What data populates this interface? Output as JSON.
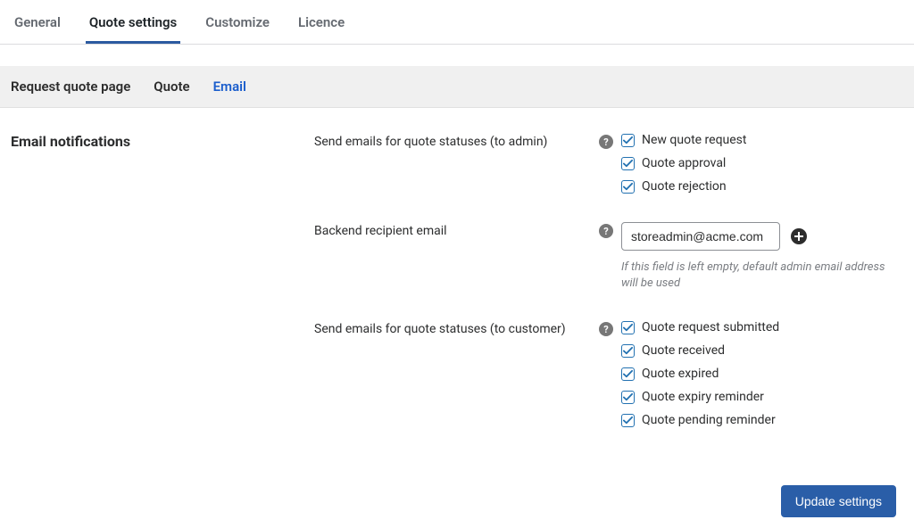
{
  "top_tabs": [
    {
      "label": "General",
      "active": false
    },
    {
      "label": "Quote settings",
      "active": true
    },
    {
      "label": "Customize",
      "active": false
    },
    {
      "label": "Licence",
      "active": false
    }
  ],
  "sub_tabs": [
    {
      "label": "Request quote page",
      "active": false
    },
    {
      "label": "Quote",
      "active": false
    },
    {
      "label": "Email",
      "active": true
    }
  ],
  "section_title": "Email notifications",
  "fields": {
    "admin_statuses": {
      "label": "Send emails for quote statuses (to admin)",
      "options": [
        {
          "label": "New quote request",
          "checked": true
        },
        {
          "label": "Quote approval",
          "checked": true
        },
        {
          "label": "Quote rejection",
          "checked": true
        }
      ]
    },
    "recipient": {
      "label": "Backend recipient email",
      "value": "storeadmin@acme.com",
      "hint": "If this field is left empty, default admin email address will be used"
    },
    "customer_statuses": {
      "label": "Send emails for quote statuses (to customer)",
      "options": [
        {
          "label": "Quote request submitted",
          "checked": true
        },
        {
          "label": "Quote received",
          "checked": true
        },
        {
          "label": "Quote expired",
          "checked": true
        },
        {
          "label": "Quote expiry reminder",
          "checked": true
        },
        {
          "label": "Quote pending reminder",
          "checked": true
        }
      ]
    }
  },
  "save_button": "Update settings"
}
